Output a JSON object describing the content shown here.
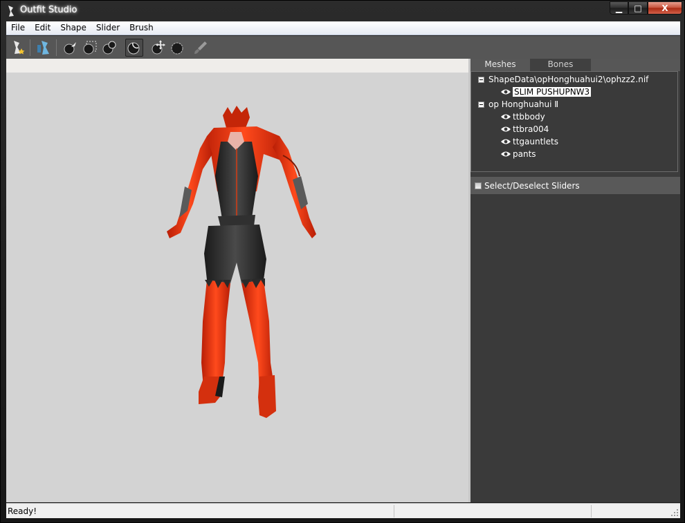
{
  "window": {
    "title": "Outfit Studio",
    "min_glyph": "▁",
    "max_glyph": "□",
    "close_glyph": "X"
  },
  "menu": [
    "File",
    "Edit",
    "Shape",
    "Slider",
    "Brush"
  ],
  "toolbar": {
    "icons": [
      "new-project-icon",
      "load-reference-icon",
      "select-brush-icon",
      "mask-brush-icon",
      "inflate-brush-icon",
      "deflate-brush-icon",
      "move-brush-icon",
      "smooth-brush-icon",
      "weight-brush-icon"
    ],
    "active": "deflate-brush-icon"
  },
  "panel": {
    "tabs": [
      "Meshes",
      "Bones"
    ],
    "active_tab": "Meshes",
    "tree": {
      "group1": {
        "label": "ShapeData\\opHonghuahui2\\ophzz2.nif",
        "children": [
          "SLIM PUSHUPNW3"
        ]
      },
      "group2": {
        "label": "op Honghuahui Ⅱ",
        "children": [
          "ttbbody",
          "ttbra004",
          "ttgauntlets",
          "pants"
        ]
      }
    },
    "select_sliders_label": "Select/Deselect Sliders"
  },
  "status": {
    "text": "Ready!"
  },
  "colors": {
    "outfit_red": "#e0320e",
    "outfit_black": "#2a2a2a",
    "viewport_bg": "#d3d3d3",
    "panel_bg": "#3c3c3c"
  }
}
